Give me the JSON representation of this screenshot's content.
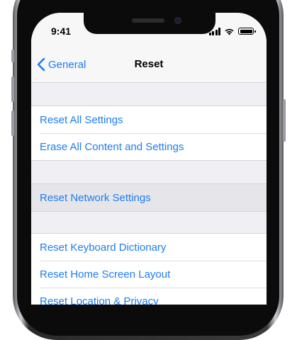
{
  "status": {
    "time": "9:41"
  },
  "nav": {
    "back_label": "General",
    "title": "Reset"
  },
  "groups": [
    {
      "items": [
        {
          "label": "Reset All Settings"
        },
        {
          "label": "Erase All Content and Settings"
        }
      ]
    },
    {
      "items": [
        {
          "label": "Reset Network Settings",
          "highlighted": true
        }
      ]
    },
    {
      "items": [
        {
          "label": "Reset Keyboard Dictionary"
        },
        {
          "label": "Reset Home Screen Layout"
        },
        {
          "label": "Reset Location & Privacy"
        }
      ]
    }
  ],
  "colors": {
    "accent": "#1e7cf2",
    "grouped_background": "#efeff4",
    "nav_background": "#f7f7f7"
  },
  "icons": {
    "back": "chevron-left-icon",
    "signal": "cellular-signal-icon",
    "wifi": "wifi-icon",
    "battery": "battery-icon"
  }
}
